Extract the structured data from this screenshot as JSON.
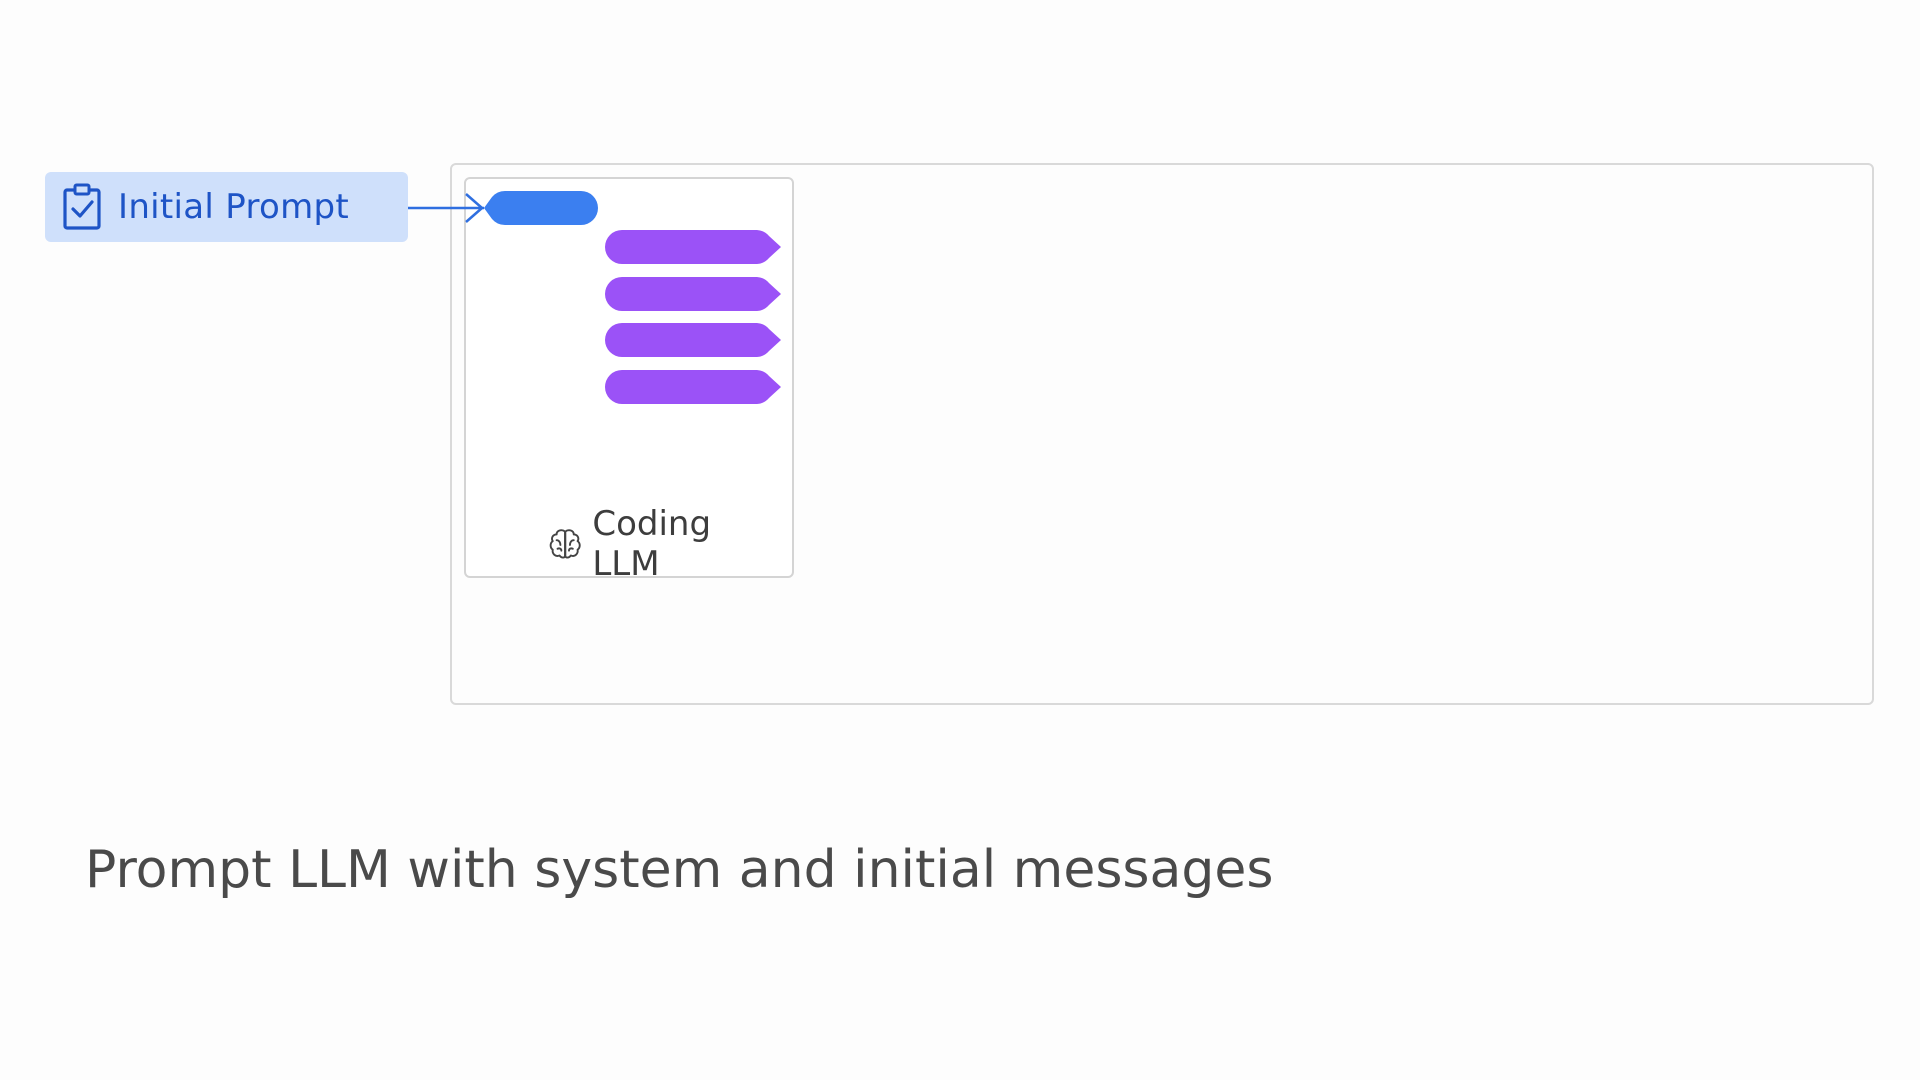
{
  "input": {
    "label": "Initial Prompt",
    "icon": "clipboard-check-icon"
  },
  "llm": {
    "label": "Coding LLM",
    "icon": "brain-icon",
    "system_messages_count": 4
  },
  "caption": "Prompt LLM with system and initial messages",
  "colors": {
    "prompt_chip_bg": "#cfe0fb",
    "prompt_text": "#1e54c6",
    "user_message": "#3b7ff0",
    "system_message": "#9b52f7",
    "frame_border": "#d9d9d9"
  }
}
